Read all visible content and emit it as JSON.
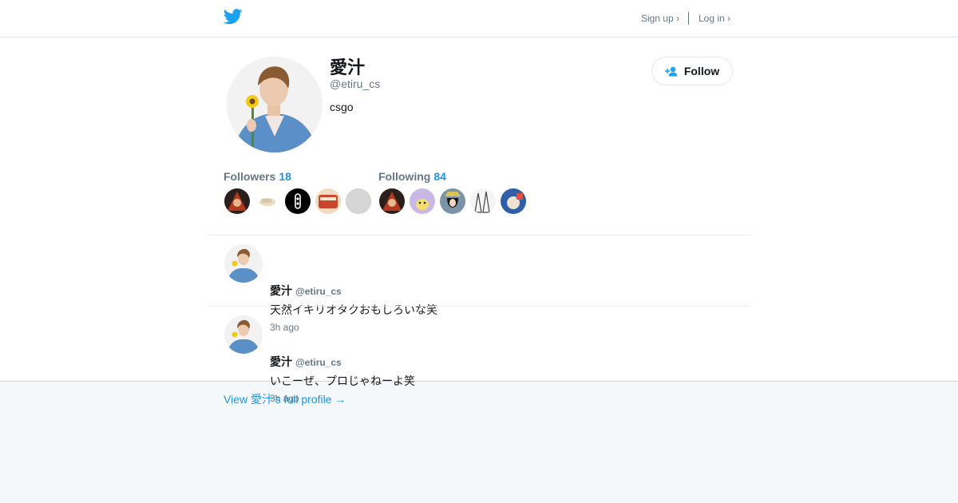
{
  "header": {
    "logo_icon": "twitter-bird-icon",
    "signup_label": "Sign up ›",
    "login_label": "Log in ›"
  },
  "profile": {
    "name": "愛汁",
    "handle": "@etiru_cs",
    "bio": "csgo",
    "follow_label": "Follow",
    "follow_icon": "add-person-icon"
  },
  "stats": {
    "followers_label": "Followers",
    "followers_count": "18",
    "following_label": "Following",
    "following_count": "84"
  },
  "tweets": [
    {
      "name": "愛汁",
      "handle": "@etiru_cs",
      "text": "天然イキリオタクおもしろいな笑",
      "time": "3h ago"
    },
    {
      "name": "愛汁",
      "handle": "@etiru_cs",
      "text": "いこーぜ、プロじゃねーよ笑",
      "time": "3h ago"
    }
  ],
  "footer": {
    "full_profile_label": "View 愛汁's full profile →"
  },
  "colors": {
    "accent": "#1b95e0",
    "twitter_blue": "#1da1f2",
    "muted": "#657786",
    "footer_bg": "#f5f8fa"
  }
}
